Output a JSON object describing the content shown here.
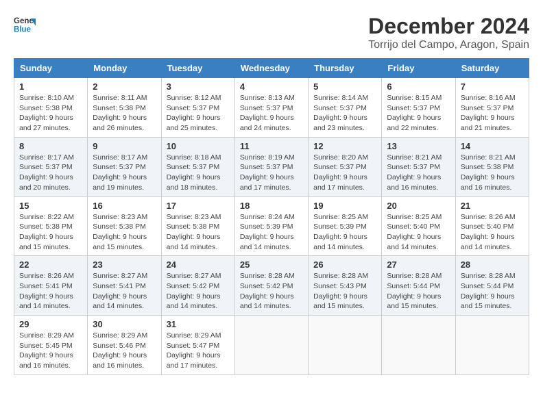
{
  "logo": {
    "line1": "General",
    "line2": "Blue"
  },
  "title": "December 2024",
  "subtitle": "Torrijo del Campo, Aragon, Spain",
  "days_of_week": [
    "Sunday",
    "Monday",
    "Tuesday",
    "Wednesday",
    "Thursday",
    "Friday",
    "Saturday"
  ],
  "weeks": [
    [
      {
        "day": "1",
        "sunrise": "8:10 AM",
        "sunset": "5:38 PM",
        "daylight": "9 hours and 27 minutes."
      },
      {
        "day": "2",
        "sunrise": "8:11 AM",
        "sunset": "5:38 PM",
        "daylight": "9 hours and 26 minutes."
      },
      {
        "day": "3",
        "sunrise": "8:12 AM",
        "sunset": "5:37 PM",
        "daylight": "9 hours and 25 minutes."
      },
      {
        "day": "4",
        "sunrise": "8:13 AM",
        "sunset": "5:37 PM",
        "daylight": "9 hours and 24 minutes."
      },
      {
        "day": "5",
        "sunrise": "8:14 AM",
        "sunset": "5:37 PM",
        "daylight": "9 hours and 23 minutes."
      },
      {
        "day": "6",
        "sunrise": "8:15 AM",
        "sunset": "5:37 PM",
        "daylight": "9 hours and 22 minutes."
      },
      {
        "day": "7",
        "sunrise": "8:16 AM",
        "sunset": "5:37 PM",
        "daylight": "9 hours and 21 minutes."
      }
    ],
    [
      {
        "day": "8",
        "sunrise": "8:17 AM",
        "sunset": "5:37 PM",
        "daylight": "9 hours and 20 minutes."
      },
      {
        "day": "9",
        "sunrise": "8:17 AM",
        "sunset": "5:37 PM",
        "daylight": "9 hours and 19 minutes."
      },
      {
        "day": "10",
        "sunrise": "8:18 AM",
        "sunset": "5:37 PM",
        "daylight": "9 hours and 18 minutes."
      },
      {
        "day": "11",
        "sunrise": "8:19 AM",
        "sunset": "5:37 PM",
        "daylight": "9 hours and 17 minutes."
      },
      {
        "day": "12",
        "sunrise": "8:20 AM",
        "sunset": "5:37 PM",
        "daylight": "9 hours and 17 minutes."
      },
      {
        "day": "13",
        "sunrise": "8:21 AM",
        "sunset": "5:37 PM",
        "daylight": "9 hours and 16 minutes."
      },
      {
        "day": "14",
        "sunrise": "8:21 AM",
        "sunset": "5:38 PM",
        "daylight": "9 hours and 16 minutes."
      }
    ],
    [
      {
        "day": "15",
        "sunrise": "8:22 AM",
        "sunset": "5:38 PM",
        "daylight": "9 hours and 15 minutes."
      },
      {
        "day": "16",
        "sunrise": "8:23 AM",
        "sunset": "5:38 PM",
        "daylight": "9 hours and 15 minutes."
      },
      {
        "day": "17",
        "sunrise": "8:23 AM",
        "sunset": "5:38 PM",
        "daylight": "9 hours and 14 minutes."
      },
      {
        "day": "18",
        "sunrise": "8:24 AM",
        "sunset": "5:39 PM",
        "daylight": "9 hours and 14 minutes."
      },
      {
        "day": "19",
        "sunrise": "8:25 AM",
        "sunset": "5:39 PM",
        "daylight": "9 hours and 14 minutes."
      },
      {
        "day": "20",
        "sunrise": "8:25 AM",
        "sunset": "5:40 PM",
        "daylight": "9 hours and 14 minutes."
      },
      {
        "day": "21",
        "sunrise": "8:26 AM",
        "sunset": "5:40 PM",
        "daylight": "9 hours and 14 minutes."
      }
    ],
    [
      {
        "day": "22",
        "sunrise": "8:26 AM",
        "sunset": "5:41 PM",
        "daylight": "9 hours and 14 minutes."
      },
      {
        "day": "23",
        "sunrise": "8:27 AM",
        "sunset": "5:41 PM",
        "daylight": "9 hours and 14 minutes."
      },
      {
        "day": "24",
        "sunrise": "8:27 AM",
        "sunset": "5:42 PM",
        "daylight": "9 hours and 14 minutes."
      },
      {
        "day": "25",
        "sunrise": "8:28 AM",
        "sunset": "5:42 PM",
        "daylight": "9 hours and 14 minutes."
      },
      {
        "day": "26",
        "sunrise": "8:28 AM",
        "sunset": "5:43 PM",
        "daylight": "9 hours and 15 minutes."
      },
      {
        "day": "27",
        "sunrise": "8:28 AM",
        "sunset": "5:44 PM",
        "daylight": "9 hours and 15 minutes."
      },
      {
        "day": "28",
        "sunrise": "8:28 AM",
        "sunset": "5:44 PM",
        "daylight": "9 hours and 15 minutes."
      }
    ],
    [
      {
        "day": "29",
        "sunrise": "8:29 AM",
        "sunset": "5:45 PM",
        "daylight": "9 hours and 16 minutes."
      },
      {
        "day": "30",
        "sunrise": "8:29 AM",
        "sunset": "5:46 PM",
        "daylight": "9 hours and 16 minutes."
      },
      {
        "day": "31",
        "sunrise": "8:29 AM",
        "sunset": "5:47 PM",
        "daylight": "9 hours and 17 minutes."
      },
      null,
      null,
      null,
      null
    ]
  ],
  "labels": {
    "sunrise": "Sunrise:",
    "sunset": "Sunset:",
    "daylight": "Daylight:"
  }
}
